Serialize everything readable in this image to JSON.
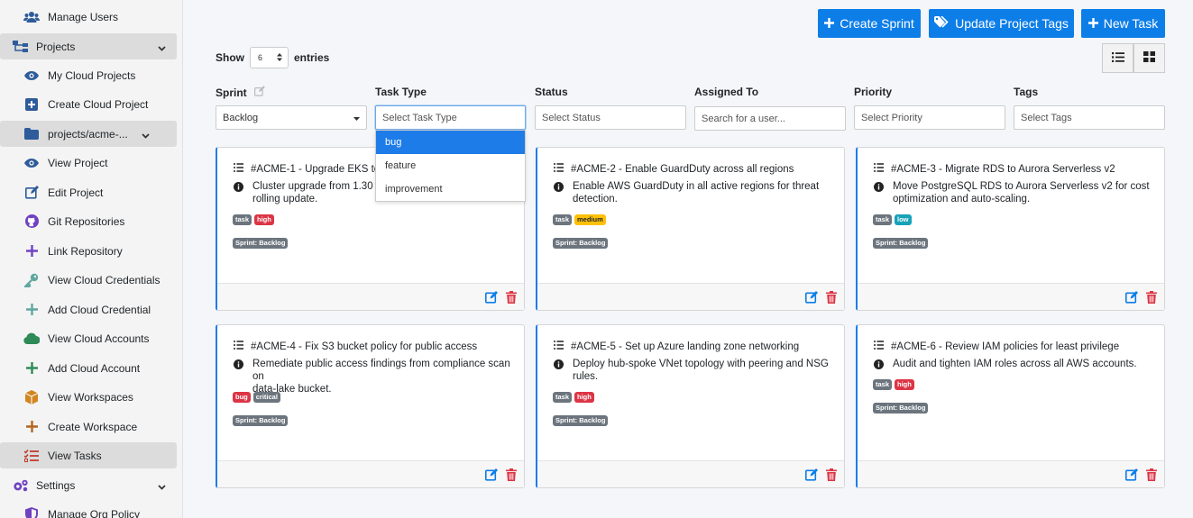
{
  "sidebar": {
    "items": [
      {
        "label": "Manage Users"
      },
      {
        "label": "Projects"
      },
      {
        "label": "My Cloud Projects"
      },
      {
        "label": "Create Cloud Project"
      },
      {
        "label": "projects/acme-..."
      },
      {
        "label": "View Project"
      },
      {
        "label": "Edit Project"
      },
      {
        "label": "Git Repositories"
      },
      {
        "label": "Link Repository"
      },
      {
        "label": "View Cloud Credentials"
      },
      {
        "label": "Add Cloud Credential"
      },
      {
        "label": "View Cloud Accounts"
      },
      {
        "label": "Add Cloud Account"
      },
      {
        "label": "View Workspaces"
      },
      {
        "label": "Create Workspace"
      },
      {
        "label": "View Tasks"
      },
      {
        "label": "Settings"
      },
      {
        "label": "Manage Org Policy"
      }
    ]
  },
  "toolbar": {
    "create_sprint": "Create Sprint",
    "update_tags": "Update Project Tags",
    "new_task": "New Task"
  },
  "entries": {
    "show": "Show",
    "value": "6",
    "suffix": "entries"
  },
  "filters": {
    "sprint": {
      "label": "Sprint",
      "value": "Backlog"
    },
    "task_type": {
      "label": "Task Type",
      "placeholder": "Select Task Type",
      "options": [
        "bug",
        "feature",
        "improvement"
      ]
    },
    "status": {
      "label": "Status",
      "placeholder": "Select Status"
    },
    "assigned": {
      "label": "Assigned To",
      "placeholder": "Search for a user..."
    },
    "priority": {
      "label": "Priority",
      "placeholder": "Select Priority"
    },
    "tags": {
      "label": "Tags",
      "placeholder": "Select Tags"
    }
  },
  "tasks": [
    {
      "title": "#ACME-1 - Upgrade EKS to 1",
      "desc": "Cluster upgrade from 1.30 to",
      "desc2": "rolling update.",
      "type": "task",
      "priority": "high",
      "sprint": "Sprint: Backlog"
    },
    {
      "title": "#ACME-2 - Enable GuardDuty across all regions",
      "desc": "Enable AWS GuardDuty in all active regions for threat",
      "desc2": "detection.",
      "type": "task",
      "priority": "medium",
      "sprint": "Sprint: Backlog"
    },
    {
      "title": "#ACME-3 - Migrate RDS to Aurora Serverless v2",
      "desc": "Move PostgreSQL RDS to Aurora Serverless v2 for cost",
      "desc2": "optimization and auto-scaling.",
      "type": "task",
      "priority": "low",
      "sprint": "Sprint: Backlog"
    },
    {
      "title": "#ACME-4 - Fix S3 bucket policy for public access",
      "desc": "Remediate public access findings from compliance scan on",
      "desc2": "data-lake bucket.",
      "type": "bug",
      "priority": "critical",
      "sprint": "Sprint: Backlog"
    },
    {
      "title": "#ACME-5 - Set up Azure landing zone networking",
      "desc": "Deploy hub-spoke VNet topology with peering and NSG",
      "desc2": "rules.",
      "type": "task",
      "priority": "high",
      "sprint": "Sprint: Backlog"
    },
    {
      "title": "#ACME-6 - Review IAM policies for least privilege",
      "desc": "Audit and tighten IAM roles across all AWS accounts.",
      "desc2": "",
      "type": "task",
      "priority": "high",
      "sprint": "Sprint: Backlog"
    }
  ],
  "colors": {
    "accent": "#0d7ee8",
    "task_badge": "#6c757d",
    "bug_badge": "#dc3545",
    "high_badge": "#dc3545",
    "medium_badge": "#ffc107",
    "low_badge": "#17a2b8",
    "critical_badge": "#6c757d",
    "delete_icon": "#dc3545"
  }
}
